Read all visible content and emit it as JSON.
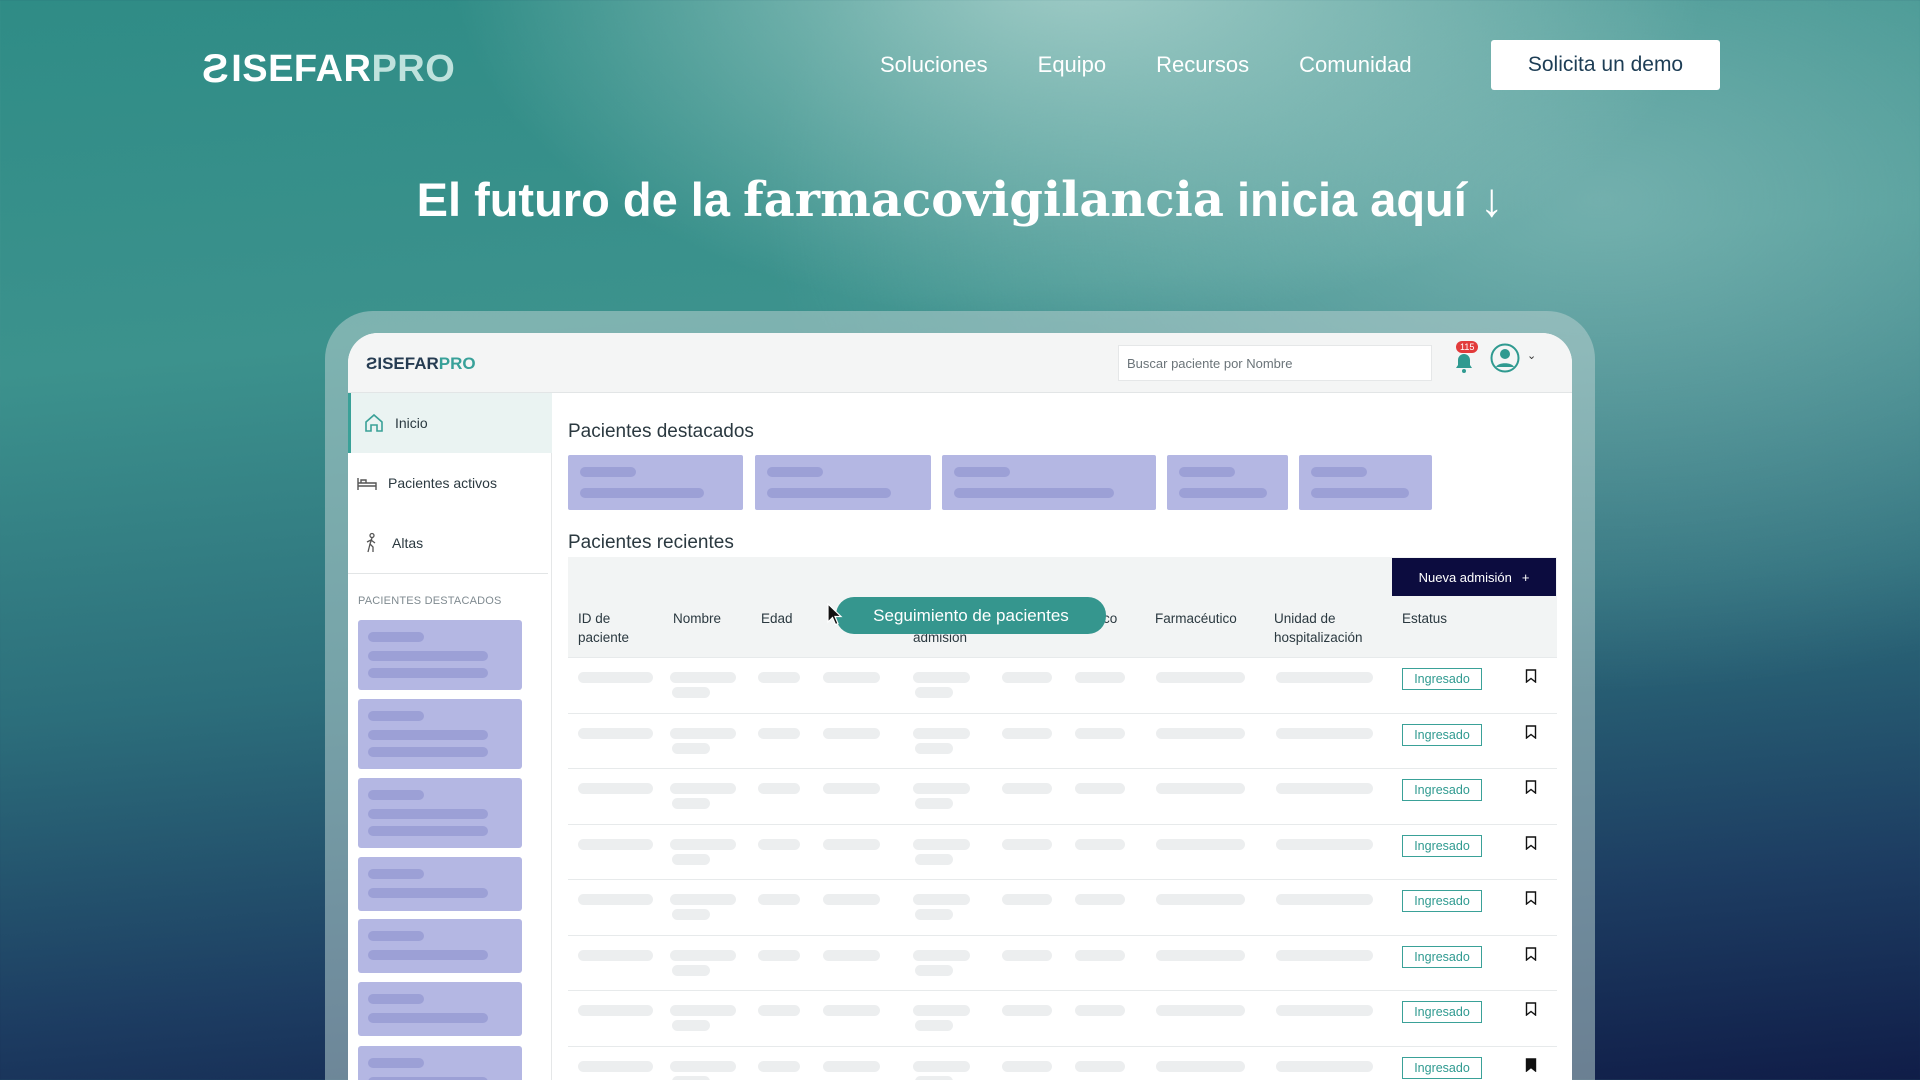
{
  "nav": {
    "logo_mark": "Ƨ",
    "logo_part1": "ISEFAR",
    "logo_part2": "PRO",
    "links": [
      "Soluciones",
      "Equipo",
      "Recursos",
      "Comunidad"
    ],
    "demo_button": "Solicita un demo"
  },
  "headline": {
    "part1": "El futuro de la ",
    "emphasis": "farmacovigilancia",
    "part2": " inicia aquí",
    "arrow": "↓"
  },
  "app": {
    "logo_part1": "ISEFAR",
    "logo_part2": "PRO",
    "search_placeholder": "Buscar paciente por Nombre",
    "notification_count": "115",
    "sidebar": {
      "items": [
        {
          "label": "Inicio",
          "icon": "home-icon"
        },
        {
          "label": "Pacientes activos",
          "icon": "bed-icon"
        },
        {
          "label": "Altas",
          "icon": "walking-person-icon"
        }
      ],
      "section_label": "PACIENTES DESTACADOS"
    },
    "featured_title": "Pacientes destacados",
    "recent_title": "Pacientes recientes",
    "new_admission_button": "Nueva admisión",
    "new_admission_icon": "+",
    "tooltip": "Seguimiento de pacientes",
    "columns": {
      "id": "ID de paciente",
      "name": "Nombre",
      "age": "Edad",
      "admission_partial": "admisión",
      "col_partial": "co",
      "pharmacist": "Farmacéutico",
      "unit": "Unidad de hospitalización",
      "status": "Estatus"
    },
    "rows": [
      {
        "status": "Ingresado",
        "bookmarked": false
      },
      {
        "status": "Ingresado",
        "bookmarked": false
      },
      {
        "status": "Ingresado",
        "bookmarked": false
      },
      {
        "status": "Ingresado",
        "bookmarked": false
      },
      {
        "status": "Ingresado",
        "bookmarked": false
      },
      {
        "status": "Ingresado",
        "bookmarked": false
      },
      {
        "status": "Ingresado",
        "bookmarked": false
      },
      {
        "status": "Ingresado",
        "bookmarked": true
      }
    ]
  },
  "colors": {
    "accent_teal": "#3aa198",
    "dark_navy": "#0c0c3f",
    "placeholder_lavender": "#b4b7e3",
    "badge_red": "#e23b3b"
  }
}
